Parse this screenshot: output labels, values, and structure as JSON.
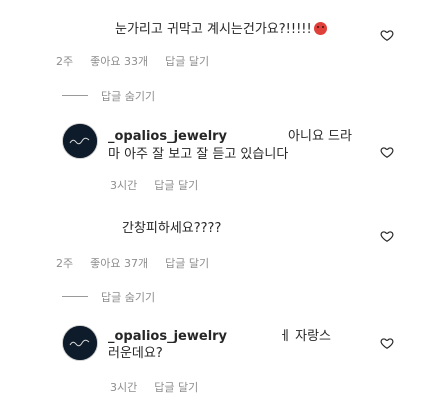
{
  "thread": {
    "comment1": {
      "text": "눈가리고 귀막고 계시는건가요?!!!!!",
      "age": "2주",
      "likes": "좋아요 33개",
      "reply": "답글 달기",
      "hide_replies": "답글 숨기기",
      "emoji_icon": "angry-face-icon"
    },
    "reply1": {
      "username": "_opalios_jewelry",
      "line1": "아니요 드라",
      "line2": "마 아주 잘 보고 잘 듣고 있습니다",
      "age": "3시간",
      "reply": "답글 달기"
    },
    "comment2": {
      "text": "간창피하세요????",
      "age": "2주",
      "likes": "좋아요 37개",
      "reply": "답글 달기",
      "hide_replies": "답글 숨기기"
    },
    "reply2": {
      "username": "_opalios_jewelry",
      "line1": "ㅔ 자랑스",
      "line2": "러운데요?",
      "age": "3시간",
      "reply": "답글 달기"
    }
  },
  "colors": {
    "text": "#262626",
    "muted": "#8e8e8e",
    "avatar_bg": "#0d1b2a"
  }
}
